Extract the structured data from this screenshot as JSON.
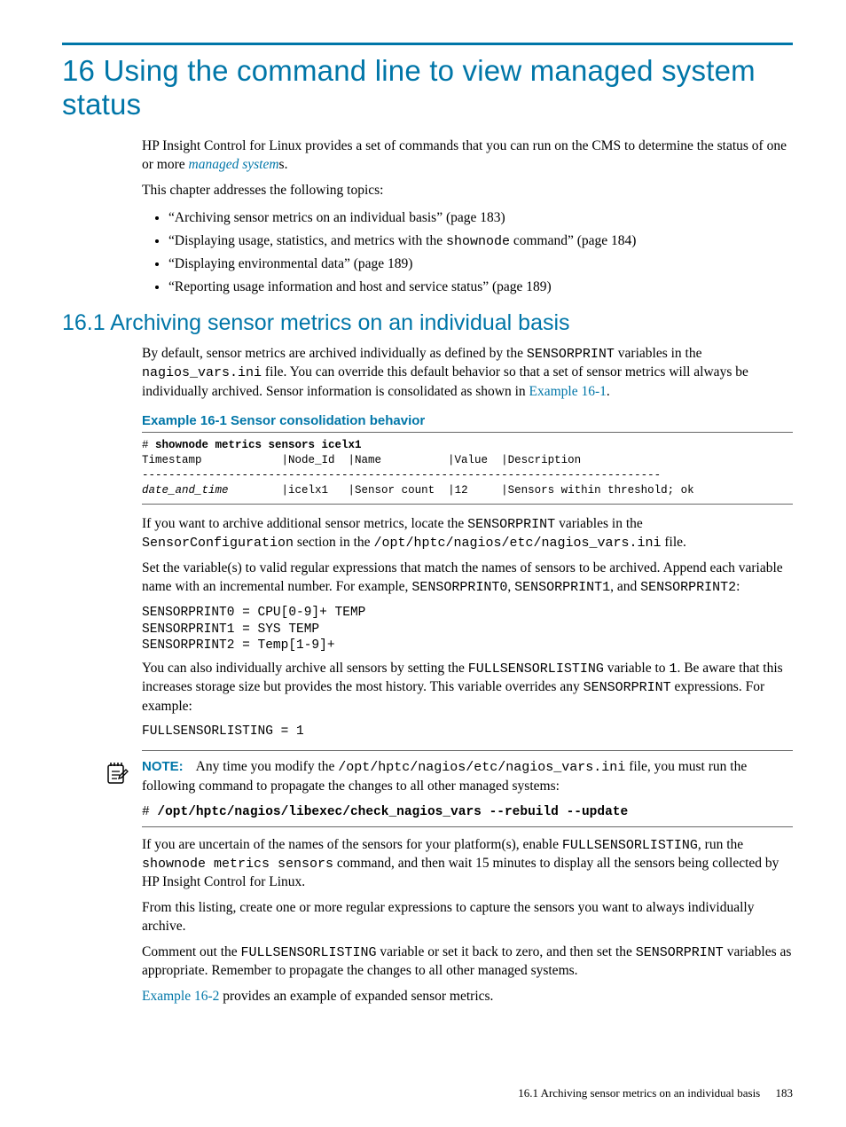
{
  "chapter": {
    "number": "16",
    "title": "16 Using the command line to view managed system status"
  },
  "intro": {
    "p1a": "HP Insight Control for Linux provides a set of commands that you can run on the CMS to determine the status of one or more ",
    "p1_link": "managed system",
    "p1b": "s.",
    "p2": "This chapter addresses the following topics:"
  },
  "topics": [
    "“Archiving sensor metrics on an individual basis” (page 183)",
    "“Displaying usage, statistics, and metrics with the shownode command” (page 184)",
    "“Displaying environmental data” (page 189)",
    "“Reporting usage information and host and service status” (page 189)"
  ],
  "topics_raw": {
    "t2a": "“Displaying usage, statistics, and metrics with the ",
    "t2code": "shownode",
    "t2b": " command” (page 184)"
  },
  "section": {
    "title": "16.1 Archiving sensor metrics on an individual basis",
    "p1a": "By default, sensor metrics are archived individually as defined by the ",
    "p1c1": "SENSORPRINT",
    "p1b": " variables in the ",
    "p1c2": "nagios_vars.ini",
    "p1c": " file. You can override this default behavior so that a set of sensor metrics will always be individually archived. Sensor information is consolidated as shown in ",
    "p1link": "Example 16-1",
    "p1d": "."
  },
  "example": {
    "title": "Example 16-1 Sensor consolidation behavior",
    "line1_prompt": "# ",
    "line1_cmd": "shownode metrics sensors icelx1",
    "line2": "Timestamp            |Node_Id  |Name          |Value  |Description",
    "line3": "------------------------------------------------------------------------------",
    "line4_ts": "date_and_time",
    "line4_rest": "        |icelx1   |Sensor count  |12     |Sensors within threshold; ok"
  },
  "after_example": {
    "p1a": "If you want to archive additional sensor metrics, locate the ",
    "p1c1": "SENSORPRINT",
    "p1b": " variables in the ",
    "p1c2": "SensorConfiguration",
    "p1c": " section in the ",
    "p1c3": "/opt/hptc/nagios/etc/nagios_vars.ini",
    "p1d": " file.",
    "p2a": "Set the variable(s) to valid regular expressions that match the names of sensors to be archived. Append each variable name with an incremental number. For example, ",
    "p2c1": "SENSORPRINT0",
    "p2b": ", ",
    "p2c2": "SENSORPRINT1",
    "p2c": ", and ",
    "p2c3": "SENSORPRINT2",
    "p2d": ":",
    "code1": "SENSORPRINT0 = CPU[0-9]+ TEMP\nSENSORPRINT1 = SYS TEMP\nSENSORPRINT2 = Temp[1-9]+",
    "p3a": "You can also individually archive all sensors by setting the ",
    "p3c1": "FULLSENSORLISTING",
    "p3b": " variable to ",
    "p3c2": "1",
    "p3c": ". Be aware that this increases storage size but provides the most history. This variable overrides any ",
    "p3c3": "SENSORPRINT",
    "p3d": " expressions. For example:",
    "code2": "FULLSENSORLISTING = 1"
  },
  "note": {
    "label": "NOTE:",
    "t1a": "Any time you modify the ",
    "t1c": "/opt/hptc/nagios/etc/nagios_vars.ini",
    "t1b": " file, you must run the following command to propagate the changes to all other managed systems:",
    "cmd_prompt": "# ",
    "cmd": "/opt/hptc/nagios/libexec/check_nagios_vars --rebuild --update"
  },
  "after_note": {
    "p1a": "If you are uncertain of the names of the sensors for your platform(s), enable ",
    "p1c1": "FULLSENSORLISTING",
    "p1b": ", run the ",
    "p1c2": "shownode metrics sensors",
    "p1c": " command, and then wait 15 minutes to display all the sensors being collected by HP Insight Control for Linux.",
    "p2": "From this listing, create one or more regular expressions to capture the sensors you want to always individually archive.",
    "p3a": "Comment out the ",
    "p3c1": "FULLSENSORLISTING",
    "p3b": " variable or set it back to zero, and then set the ",
    "p3c2": "SENSORPRINT",
    "p3c": " variables as appropriate. Remember to propagate the changes to all other managed systems.",
    "p4link": "Example 16-2",
    "p4b": " provides an example of expanded sensor metrics."
  },
  "footer": {
    "text": "16.1 Archiving sensor metrics on an individual basis",
    "page": "183"
  }
}
